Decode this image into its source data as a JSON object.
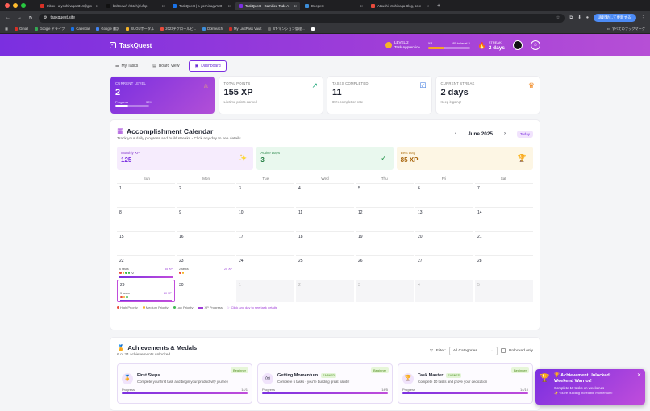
{
  "browser": {
    "tabs": [
      {
        "label": "Inbox - a.yoshinaga0314@gm",
        "fav": "#d93025",
        "active": false
      },
      {
        "label": "bolt.new/~/sb1-hjrfufbp",
        "fav": "#111111",
        "active": false
      },
      {
        "label": "TaskQuest | a-yoshinaga's O",
        "fav": "#1a73e8",
        "active": false
      },
      {
        "label": "TaskQuest - Gamified Todo A",
        "fav": "#7b2fe0",
        "active": true
      },
      {
        "label": "Deepest",
        "fav": "#3c8dd9",
        "active": false
      },
      {
        "label": "Atsushi Yoshinaga Blog, so-c",
        "fav": "#e94b3c",
        "active": false
      }
    ],
    "url": "taskquest.site",
    "update_label": "再起動して更新する",
    "bookmarks": [
      {
        "label": "Gmail",
        "color": "#d93025"
      },
      {
        "label": "Google ドライブ",
        "color": "#34a853"
      },
      {
        "label": "Calendar",
        "color": "#1a73e8"
      },
      {
        "label": "Google 翻訳",
        "color": "#4285f4"
      },
      {
        "label": "SUGUポータル",
        "color": "#f5b428"
      },
      {
        "label": "2023テクロールビ...",
        "color": "#e94b3c"
      },
      {
        "label": "Dolmeach",
        "color": "#3c8dd9"
      },
      {
        "label": "My LastPass Vault",
        "color": "#d32d27"
      },
      {
        "label": "ST-マンション管理...",
        "color": "#6c6c6c"
      },
      {
        "label": "",
        "color": "#ffffff"
      }
    ],
    "bookmarks_right": "すべてのブックマーク"
  },
  "appbar": {
    "brand": "TaskQuest",
    "level_label": "LEVEL",
    "level_value": "2",
    "level_title": "Task Apprentice",
    "xp_label": "XP",
    "xp_to_level": "85 to level 3",
    "xp_progress_pct": 38,
    "streak_label": "STREAK",
    "streak_value": "2 days"
  },
  "nav": {
    "my_tasks": "My Tasks",
    "board_view": "Board View",
    "dashboard": "Dashboard"
  },
  "stats": {
    "current_level": {
      "label": "CURRENT LEVEL",
      "value": "2",
      "progress_label": "Progress",
      "progress_value": "38%",
      "progress_pct": 38
    },
    "total_points": {
      "label": "TOTAL POINTS",
      "value": "155 XP",
      "sub": "Lifetime points earned"
    },
    "tasks_completed": {
      "label": "TASKS COMPLETED",
      "value": "11",
      "sub": "85% completion rate"
    },
    "current_streak": {
      "label": "CURRENT STREAK",
      "value": "2 days",
      "sub": "Keep it going!"
    }
  },
  "calendar": {
    "title": "Accomplishment Calendar",
    "subtitle": "Track your daily progress and build streaks - Click any day to see details",
    "month": "June 2025",
    "today_label": "Today",
    "monthly_xp_label": "Monthly XP",
    "monthly_xp": "125",
    "active_days_label": "Active Days",
    "active_days": "3",
    "best_day_label": "Best Day",
    "best_day": "85 XP",
    "dows": [
      "Sun",
      "Mon",
      "Tue",
      "Wed",
      "Thu",
      "Fri",
      "Sat"
    ],
    "cells": [
      {
        "d": "1"
      },
      {
        "d": "2"
      },
      {
        "d": "3"
      },
      {
        "d": "4"
      },
      {
        "d": "5"
      },
      {
        "d": "6"
      },
      {
        "d": "7"
      },
      {
        "d": "8"
      },
      {
        "d": "9"
      },
      {
        "d": "10"
      },
      {
        "d": "11"
      },
      {
        "d": "12"
      },
      {
        "d": "13"
      },
      {
        "d": "14"
      },
      {
        "d": "15"
      },
      {
        "d": "16"
      },
      {
        "d": "17"
      },
      {
        "d": "18"
      },
      {
        "d": "19"
      },
      {
        "d": "20"
      },
      {
        "d": "21"
      },
      {
        "d": "22",
        "tasks": "6 tasks",
        "xp": "85 XP",
        "dots": [
          "#e94b3c",
          "#f5b428",
          "#3fb950",
          "#3fb950"
        ],
        "more": "+2"
      },
      {
        "d": "23",
        "tasks": "2 tasks",
        "xp": "20 XP",
        "dots": [
          "#e94b3c",
          "#f5b428"
        ]
      },
      {
        "d": "24"
      },
      {
        "d": "25"
      },
      {
        "d": "26"
      },
      {
        "d": "27"
      },
      {
        "d": "28"
      },
      {
        "d": "29",
        "tasks": "3 tasks",
        "xp": "20 XP",
        "dots": [
          "#e94b3c",
          "#f5b428",
          "#3fb950"
        ],
        "selected": true
      },
      {
        "d": "30"
      },
      {
        "d": "1",
        "other": true
      },
      {
        "d": "2",
        "other": true
      },
      {
        "d": "3",
        "other": true
      },
      {
        "d": "4",
        "other": true
      },
      {
        "d": "5",
        "other": true
      }
    ],
    "legend": {
      "high": "High Priority",
      "medium": "Medium Priority",
      "low": "Low Priority",
      "xp": "XP Progress",
      "hint": "Click any day to see task details"
    }
  },
  "achievements": {
    "title": "Achievements & Medals",
    "subtitle": "6 of 34 achievements unlocked",
    "filter_label": "Filter:",
    "filter_value": "All Categories",
    "unlocked_only": "Unlocked only",
    "cards": [
      {
        "tag": "Beginner",
        "icon": "medal",
        "title": "First Steps",
        "earned": "",
        "desc": "Complete your first task and begin your productivity journey",
        "progress_label": "Progress",
        "progress_value": "14/1"
      },
      {
        "tag": "Beginner",
        "icon": "target",
        "title": "Getting Momentum",
        "earned": "EARNED",
        "desc": "Complete 5 tasks - you're building great habits!",
        "progress_label": "Progress",
        "progress_value": "14/5"
      },
      {
        "tag": "Beginner",
        "icon": "trophy",
        "title": "Task Master",
        "earned": "EARNED",
        "desc": "Complete 10 tasks and prove your dedication",
        "progress_label": "Progress",
        "progress_value": "14/10"
      }
    ]
  },
  "toast": {
    "title": "🏆 Achievement Unlocked:",
    "name": "Weekend Warrior!",
    "desc": "Complete 10 tasks on weekends",
    "note": "✨ You're building incredible momentum!"
  }
}
